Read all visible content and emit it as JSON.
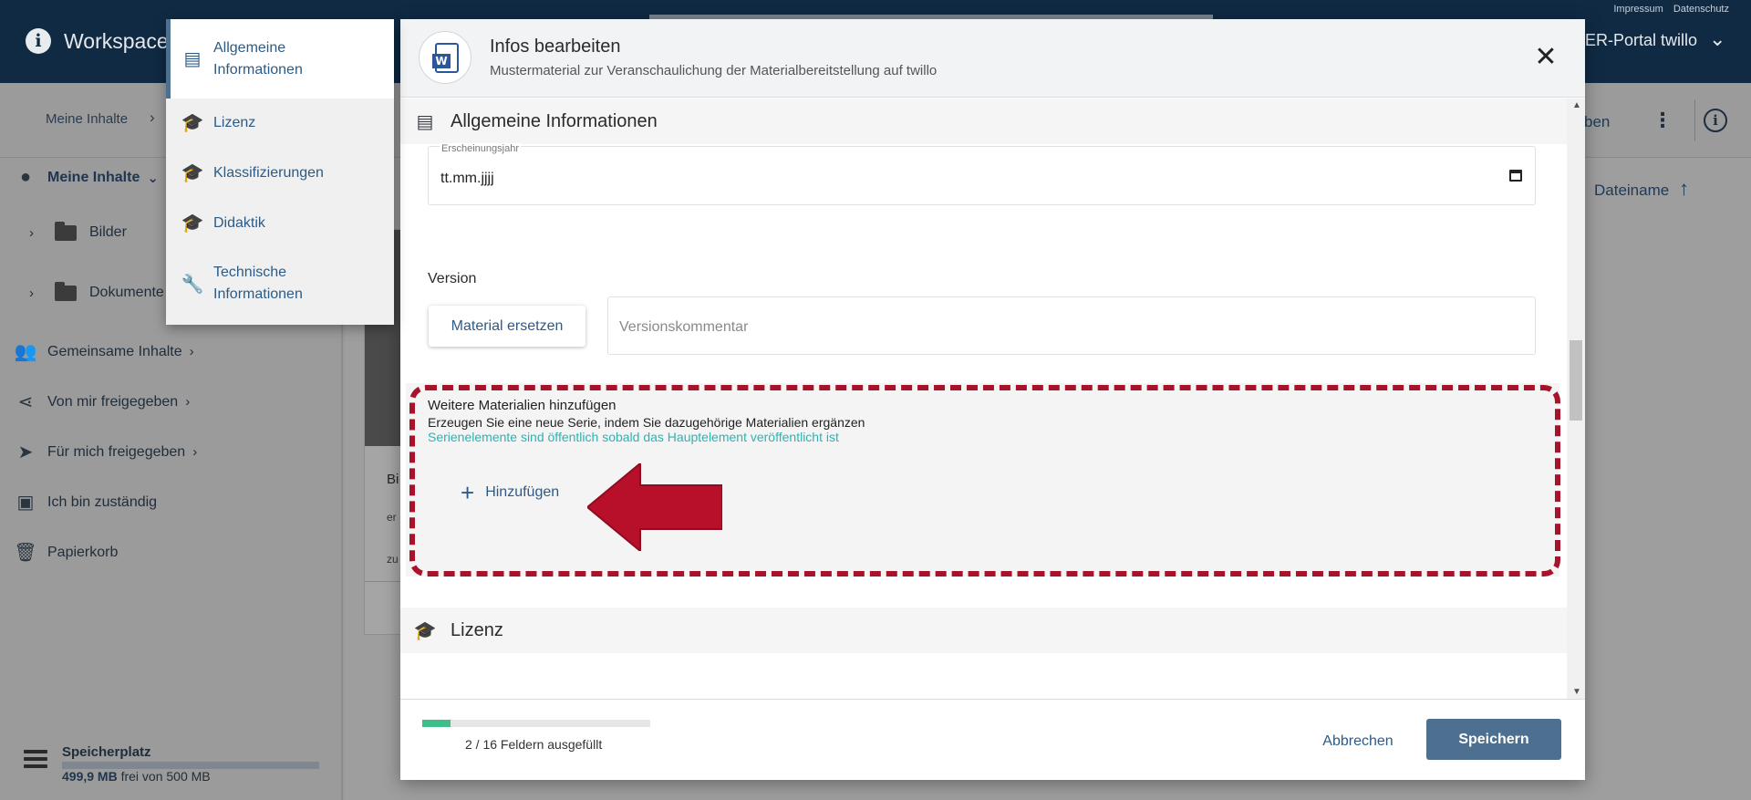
{
  "topbar": {
    "app_title": "Workspace",
    "links": [
      "Impressum",
      "Datenschutz"
    ],
    "portal": "ER-Portal twillo"
  },
  "toolbar": {
    "breadcrumb": "Meine Inhalte",
    "right_text": "ben"
  },
  "sidebar": {
    "my_content": "Meine Inhalte",
    "folders": [
      "Bilder",
      "Dokumente"
    ],
    "items": [
      "Gemeinsame Inhalte",
      "Von mir freigegeben",
      "Für mich freigegeben",
      "Ich bin zuständig",
      "Papierkorb"
    ],
    "storage_title": "Speicherplatz",
    "storage_used": "499,9 MB",
    "storage_rest": "frei von 500 MB",
    "storage_fraction": 0.9998
  },
  "background": {
    "card_t1": "Bi",
    "card_t2": "er",
    "card_t3": "zu",
    "sort_label": "Dateiname"
  },
  "section_nav": {
    "items": [
      "Allgemeine Informationen",
      "Lizenz",
      "Klassifizierungen",
      "Didaktik",
      "Technische Informationen"
    ],
    "icons": [
      "document-icon",
      "graduation-cap-icon",
      "graduation-cap-icon",
      "graduation-cap-icon",
      "wrench-icon"
    ]
  },
  "dialog": {
    "title": "Infos bearbeiten",
    "subtitle": "Mustermaterial zur Veranschaulichung der Materialbereitstellung auf twillo",
    "section_general": "Allgemeine Informationen",
    "year_label": "Erscheinungsjahr",
    "year_value": "tt.mm.jjjj",
    "version_label": "Version",
    "replace_button": "Material ersetzen",
    "version_comment_placeholder": "Versionskommentar",
    "series_title": "Weitere Materialien hinzufügen",
    "series_desc": "Erzeugen Sie eine neue Serie, indem Sie dazugehörige Materialien ergänzen",
    "series_note": "Serienelemente sind öffentlich sobald das Hauptelement veröffentlicht ist",
    "add_button": "Hinzufügen",
    "section_license": "Lizenz"
  },
  "footer": {
    "progress_text": "2 / 16 Feldern ausgefüllt",
    "progress_fraction": 0.125,
    "cancel": "Abbrechen",
    "save": "Speichern"
  },
  "colors": {
    "primary": "#4d7091",
    "link": "#2d5b85",
    "success": "#3dbe8b",
    "note": "#2db3b3",
    "highlight": "#a8132c"
  }
}
